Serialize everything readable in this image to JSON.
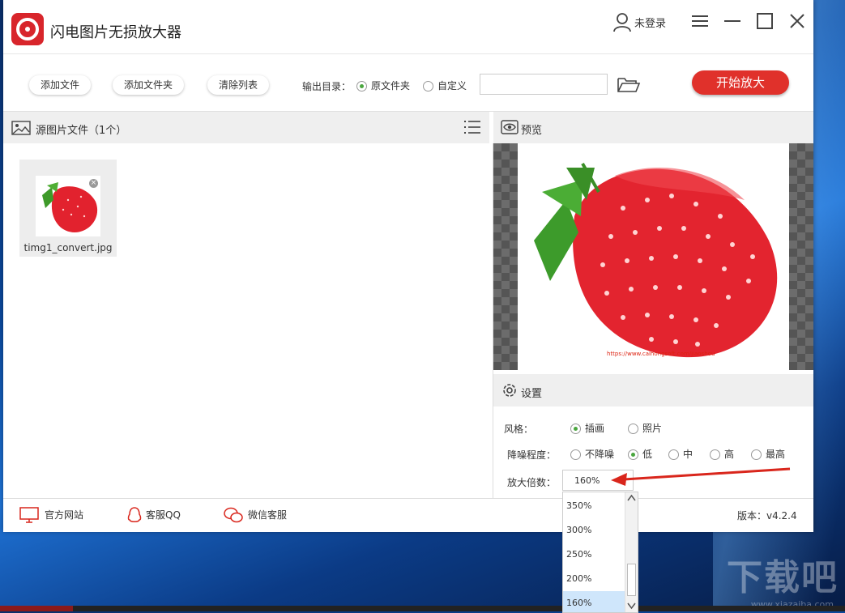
{
  "app": {
    "title": "闪电图片无损放大器",
    "login_label": "未登录"
  },
  "toolbar": {
    "add_file": "添加文件",
    "add_folder": "添加文件夹",
    "clear_list": "清除列表",
    "output_label": "输出目录：",
    "output_options": [
      {
        "label": "原文件夹",
        "selected": true
      },
      {
        "label": "自定义",
        "selected": false
      }
    ],
    "output_path": "",
    "start_button": "开始放大"
  },
  "source_panel": {
    "title": "源图片文件（1个）",
    "files": [
      {
        "name": "timg1_convert.jpg"
      }
    ]
  },
  "preview_panel": {
    "title": "预览",
    "image_caption": "https://www.caihongsoft.com/jiaoshou"
  },
  "settings_panel": {
    "title": "设置",
    "style_label": "风格：",
    "style_options": [
      {
        "label": "插画",
        "selected": true
      },
      {
        "label": "照片",
        "selected": false
      }
    ],
    "denoise_label": "降噪程度：",
    "denoise_options": [
      {
        "label": "不降噪",
        "selected": false
      },
      {
        "label": "低",
        "selected": true
      },
      {
        "label": "中",
        "selected": false
      },
      {
        "label": "高",
        "selected": false
      },
      {
        "label": "最高",
        "selected": false
      }
    ],
    "scale_label": "放大倍数：",
    "scale_value": "160%",
    "scale_options": [
      "350%",
      "300%",
      "250%",
      "200%",
      "160%"
    ]
  },
  "footer": {
    "website": "官方网站",
    "qq": "客服QQ",
    "wechat": "微信客服",
    "version": "版本：v4.2.4"
  },
  "desktop": {
    "watermark": "下载吧",
    "watermark_url": "www.xiazaiba.com"
  },
  "colors": {
    "accent_red": "#e0312b",
    "radio_green": "#4aa63f",
    "arrow_red": "#d9261c"
  }
}
